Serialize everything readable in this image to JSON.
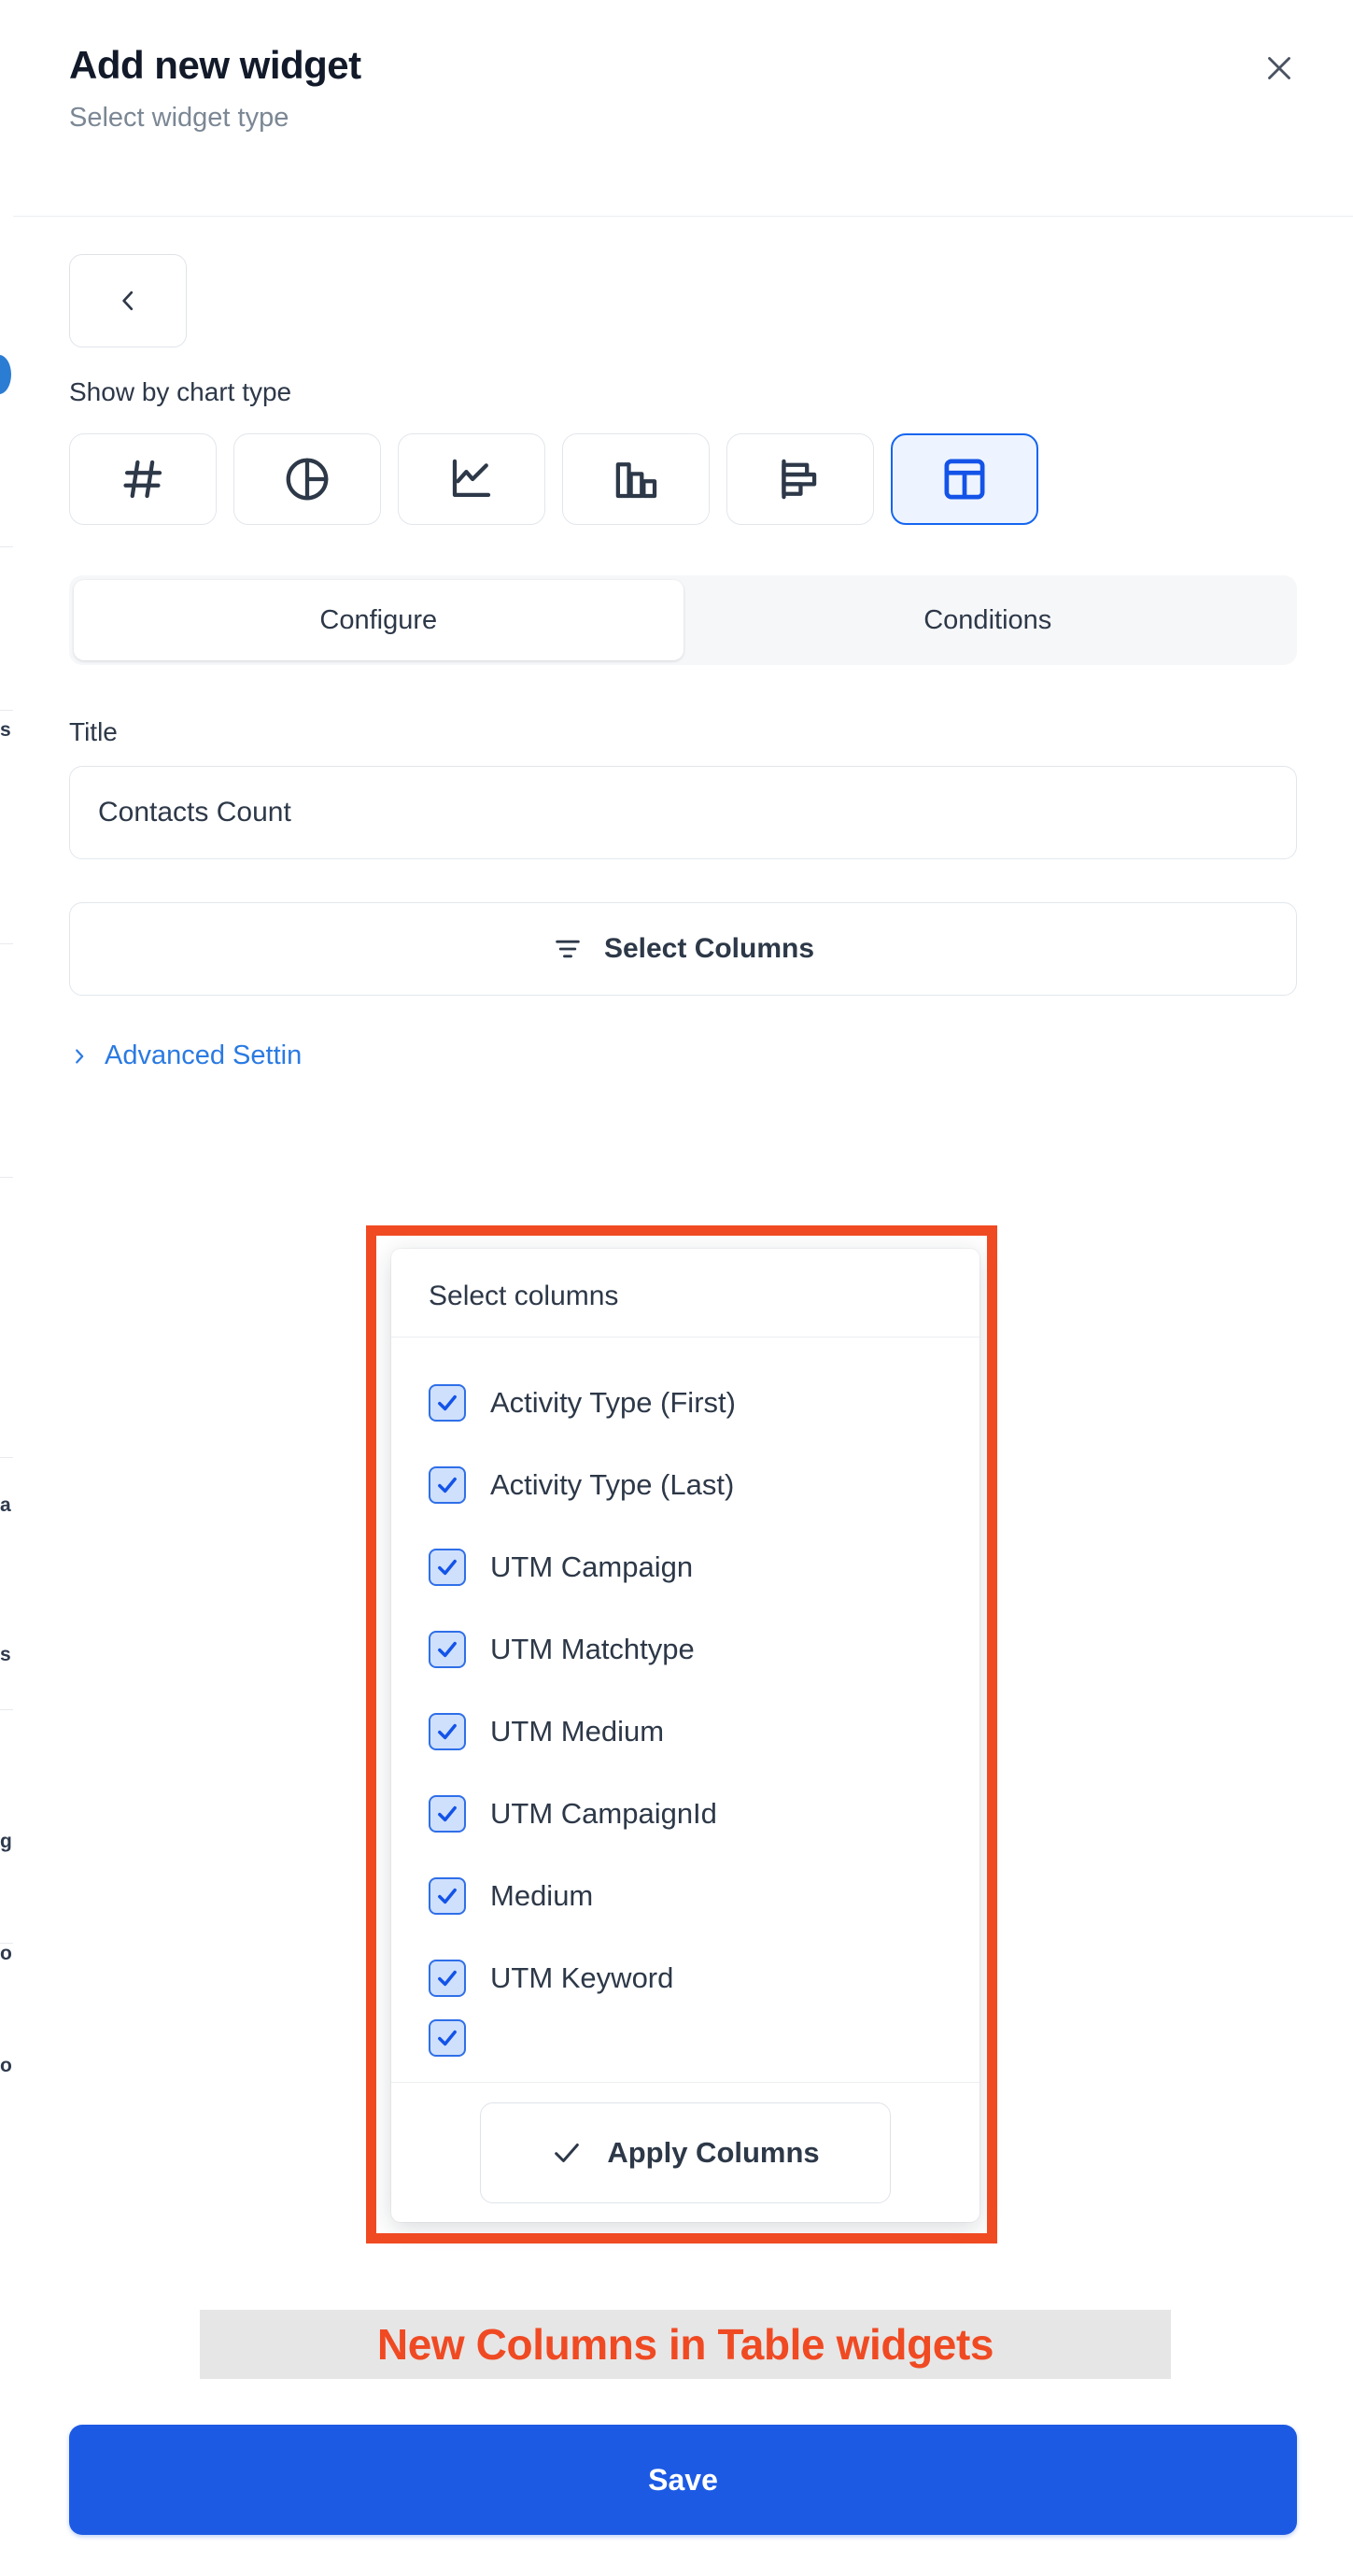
{
  "background_sliver": {
    "fragments": [
      "s",
      "a",
      "s",
      "g",
      "o",
      "o"
    ]
  },
  "dialog": {
    "title": "Add new widget",
    "subtitle": "Select widget type",
    "close_icon": "close-icon"
  },
  "navigation": {
    "back_icon": "chevron-left-icon"
  },
  "chart_type": {
    "label": "Show by chart type",
    "options": [
      {
        "name": "number",
        "icon": "hash-icon",
        "selected": false
      },
      {
        "name": "pie",
        "icon": "pie-chart-icon",
        "selected": false
      },
      {
        "name": "line",
        "icon": "line-chart-icon",
        "selected": false
      },
      {
        "name": "column",
        "icon": "bar-chart-vertical-icon",
        "selected": false
      },
      {
        "name": "bar",
        "icon": "bar-chart-horizontal-icon",
        "selected": false
      },
      {
        "name": "table",
        "icon": "table-icon",
        "selected": true
      }
    ]
  },
  "tabs": [
    {
      "label": "Configure",
      "active": true
    },
    {
      "label": "Conditions",
      "active": false
    }
  ],
  "form": {
    "title_label": "Title",
    "title_value": "Contacts Count",
    "title_placeholder": "Enter title",
    "select_columns_label": "Select Columns",
    "select_columns_icon": "filter-icon",
    "advanced_settings_label": "Advanced Settin",
    "advanced_settings_icon": "chevron-right-icon"
  },
  "columns_dropdown": {
    "header": "Select columns",
    "items": [
      {
        "label": "Activity Type (First)",
        "checked": true
      },
      {
        "label": "Activity Type (Last)",
        "checked": true
      },
      {
        "label": "UTM Campaign",
        "checked": true
      },
      {
        "label": "UTM Matchtype",
        "checked": true
      },
      {
        "label": "UTM Medium",
        "checked": true
      },
      {
        "label": "UTM CampaignId",
        "checked": true
      },
      {
        "label": "Medium",
        "checked": true
      },
      {
        "label": "UTM Keyword",
        "checked": true
      },
      {
        "label": "",
        "checked": true
      }
    ],
    "apply_label": "Apply Columns",
    "apply_icon": "check-icon"
  },
  "annotation": {
    "caption": "New Columns in Table widgets",
    "box_color": "#f04a23",
    "caption_color": "#f04a23",
    "caption_background": "#e6e6e6"
  },
  "footer": {
    "save_label": "Save",
    "save_color": "#1d5ae4"
  }
}
